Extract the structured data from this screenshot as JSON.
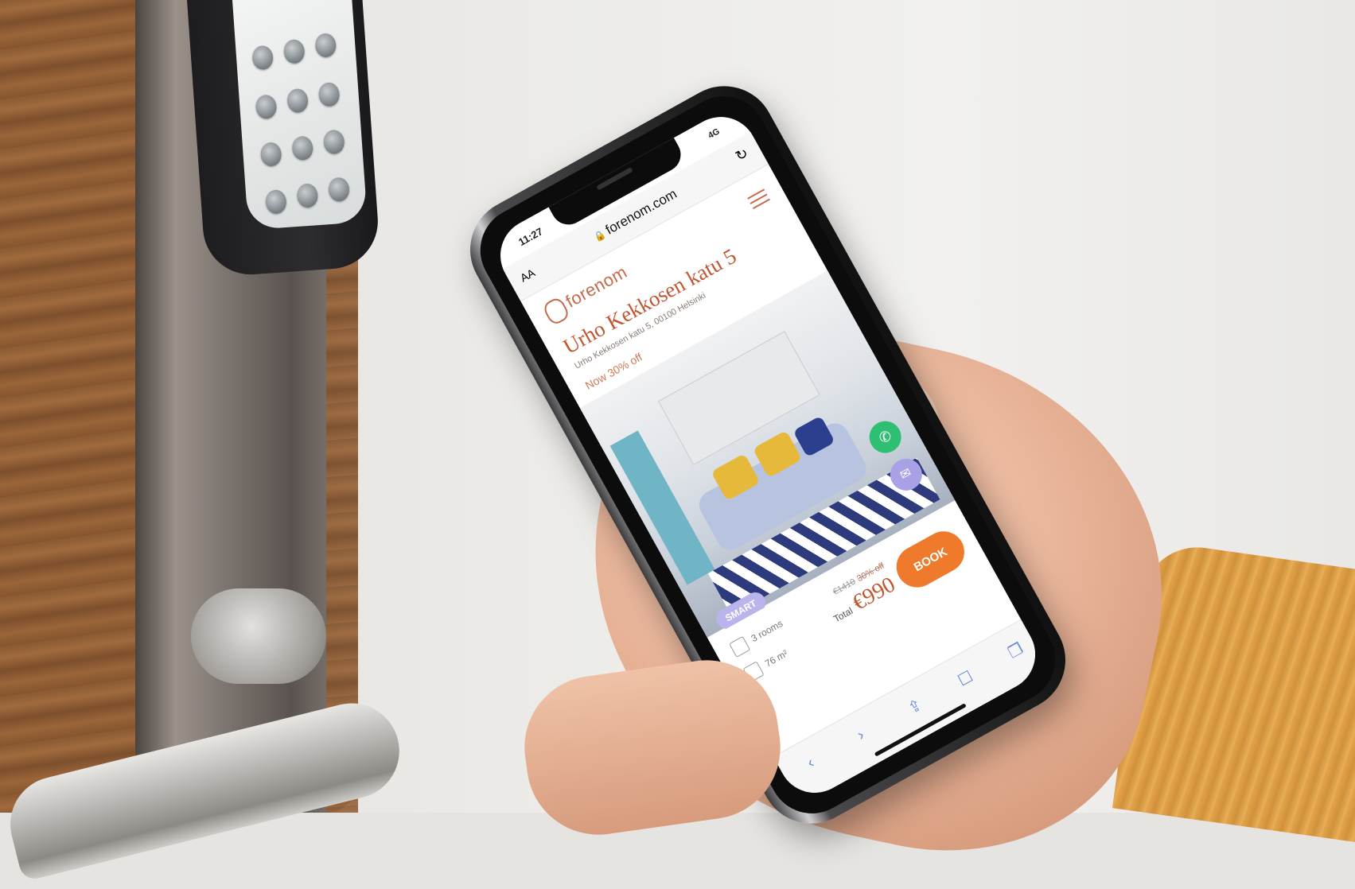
{
  "status": {
    "time": "11:27",
    "signal": "4G"
  },
  "browser": {
    "text_size": "AA",
    "url": "forenom.com",
    "reload": "↻"
  },
  "site": {
    "logo": "forenom"
  },
  "listing": {
    "title": "Urho Kekkosen katu 5",
    "address": "Urho Kekkosen katu 5, 00100 Helsinki",
    "discount": "Now 30% off",
    "badge": "SMART",
    "rooms": "3 rooms",
    "area": "76 m²",
    "old_price": "€1410",
    "off": "30% off",
    "total_label": "Total",
    "total": "€990",
    "book": "BOOK"
  },
  "toolbar": {
    "back": "‹",
    "forward": "›",
    "share": "⇪",
    "bookmarks": "☐",
    "tabs": "❐"
  }
}
